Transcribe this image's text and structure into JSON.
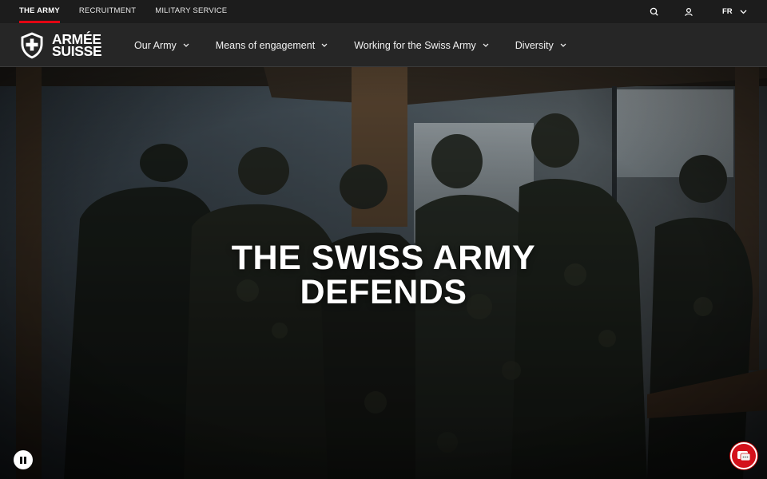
{
  "topbar": {
    "tabs": [
      {
        "label": "THE ARMY",
        "active": true
      },
      {
        "label": "RECRUITMENT",
        "active": false
      },
      {
        "label": "MILITARY SERVICE",
        "active": false
      }
    ],
    "language": "FR",
    "icons": [
      "search-icon",
      "user-icon",
      "chevron-down-icon"
    ]
  },
  "header": {
    "logo": {
      "line1": "Armée",
      "line2": "Suisse"
    },
    "nav": [
      {
        "label": "Our Army"
      },
      {
        "label": "Means of engagement"
      },
      {
        "label": "Working for the Swiss Army"
      },
      {
        "label": "Diversity"
      }
    ]
  },
  "hero": {
    "title_line1": "The Swiss Army",
    "title_line2": "Defends",
    "controls": [
      "pause-icon",
      "chat-icon"
    ]
  },
  "colors": {
    "accent": "#e30613",
    "topbar_bg": "#1c1c1c",
    "header_bg": "#262626"
  }
}
